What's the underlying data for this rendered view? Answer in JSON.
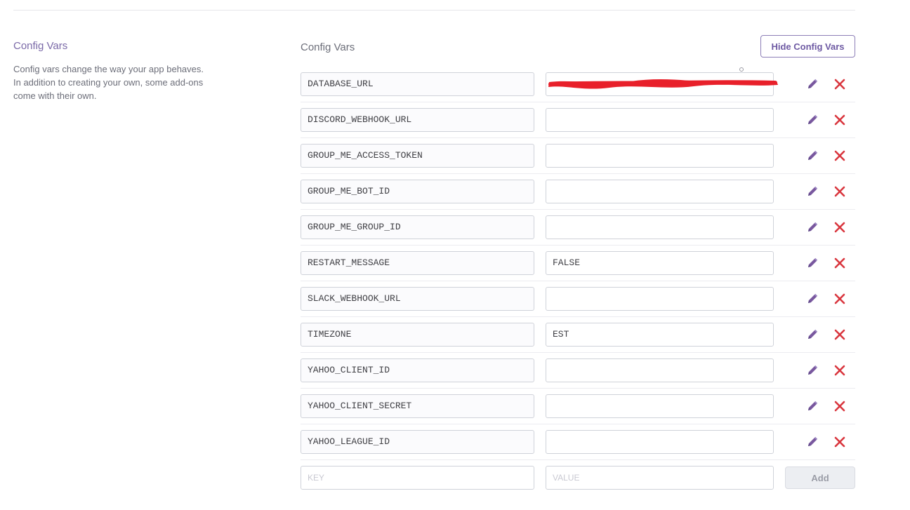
{
  "sidebar": {
    "title": "Config Vars",
    "description": "Config vars change the way your app behaves. In addition to creating your own, some add-ons come with their own."
  },
  "main": {
    "title": "Config Vars",
    "hide_button_label": "Hide Config Vars"
  },
  "config_vars": [
    {
      "key": "DATABASE_URL",
      "value": ""
    },
    {
      "key": "DISCORD_WEBHOOK_URL",
      "value": ""
    },
    {
      "key": "GROUP_ME_ACCESS_TOKEN",
      "value": ""
    },
    {
      "key": "GROUP_ME_BOT_ID",
      "value": ""
    },
    {
      "key": "GROUP_ME_GROUP_ID",
      "value": ""
    },
    {
      "key": "RESTART_MESSAGE",
      "value": "FALSE"
    },
    {
      "key": "SLACK_WEBHOOK_URL",
      "value": ""
    },
    {
      "key": "TIMEZONE",
      "value": "EST"
    },
    {
      "key": "YAHOO_CLIENT_ID",
      "value": ""
    },
    {
      "key": "YAHOO_CLIENT_SECRET",
      "value": ""
    },
    {
      "key": "YAHOO_LEAGUE_ID",
      "value": ""
    }
  ],
  "new_var": {
    "key_placeholder": "KEY",
    "value_placeholder": "VALUE",
    "add_button_label": "Add"
  },
  "icons": {
    "edit": "pencil-icon",
    "delete": "close-x-icon"
  },
  "colors": {
    "accent_purple": "#79589f",
    "delete_red": "#d9363e",
    "redaction_red": "#e8202a"
  }
}
